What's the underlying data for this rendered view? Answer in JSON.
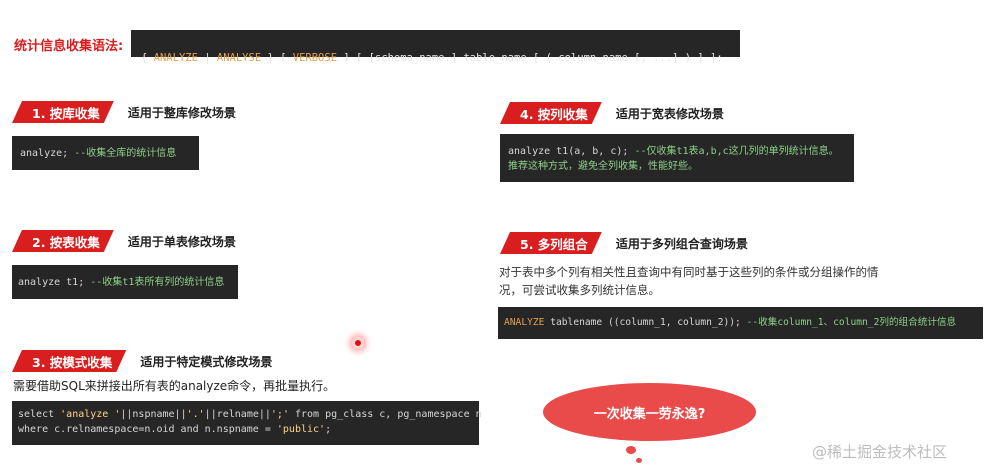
{
  "syntax": {
    "label": "统计信息收集语法:",
    "parts": {
      "p1": "{ ",
      "kw_analyze": "ANALYZE",
      "p2": " | ",
      "kw_analyse": "ANALYSE",
      "p3": " } [ ",
      "kw_verbose": "VERBOSE",
      "p4": " ] [ [schema_name.] table_name [ ( column_name [, ...] ) ] ];"
    }
  },
  "sections": [
    {
      "tag": "1. 按库收集",
      "desc": "适用于整库修改场景",
      "code": {
        "cmd": "analyze;",
        "comment": " --收集全库的统计信息"
      }
    },
    {
      "tag": "2. 按表收集",
      "desc": "适用于单表修改场景",
      "code": {
        "cmd": "analyze t1;",
        "comment": " --收集t1表所有列的统计信息"
      }
    },
    {
      "tag": "3. 按模式收集",
      "desc": "适用于特定模式修改场景",
      "note": "需要借助SQL来拼接出所有表的analyze命令，再批量执行。",
      "code": {
        "l1a": "select ",
        "l1b": "'analyze '",
        "l1c": "||nspname||",
        "l1d": "'.'",
        "l1e": "||relname||",
        "l1f": "';'",
        "l1g": " from pg_class c, pg_namespace n",
        "l2a": "where c.relnamespace=n.oid and n.nspname = ",
        "l2b": "'public'",
        "l2c": ";"
      }
    },
    {
      "tag": "4. 按列收集",
      "desc": "适用于宽表修改场景",
      "code": {
        "cmd": "analyze t1(a, b, c);",
        "comment": " --仅收集t1表a,b,c这几列的单列统计信息。",
        "comment2": "推荐这种方式，避免全列收集，性能好些。"
      }
    },
    {
      "tag": "5. 多列组合",
      "desc": "适用于多列组合查询场景",
      "note1": "对于表中多个列有相关性且查询中有同时基于这些列的条件或分组操作的情",
      "note2": "况，可尝试收集多列统计信息。",
      "code": {
        "kw": "ANALYZE",
        "cmd": " tablename ((column_1, column_2));",
        "comment": " --收集column_1、column_2列的组合统计信息"
      }
    }
  ],
  "bubble_text": "一次收集一劳永逸?",
  "watermark": "@稀土掘金技术社区",
  "colors": {
    "accent": "#d81e1e",
    "code_bg": "#262626",
    "bubble": "#e94b4b"
  }
}
